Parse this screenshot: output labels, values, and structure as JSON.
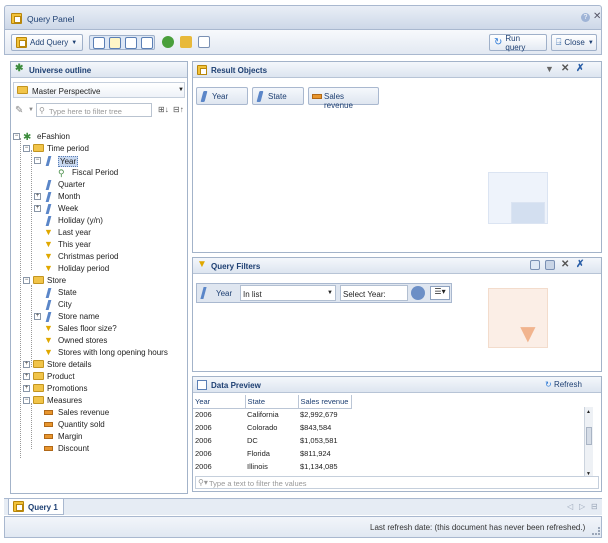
{
  "window": {
    "title": "Query Panel"
  },
  "toolbar": {
    "add_query": "Add Query",
    "run_query": "Run query",
    "close": "Close"
  },
  "universe": {
    "header": "Universe outline",
    "perspective": "Master Perspective",
    "filter_placeholder": "Type here to filter tree",
    "tree": [
      {
        "label": "eFashion"
      },
      {
        "label": "Time period"
      },
      {
        "label": "Year"
      },
      {
        "label": "Fiscal Period"
      },
      {
        "label": "Quarter"
      },
      {
        "label": "Month"
      },
      {
        "label": "Week"
      },
      {
        "label": "Holiday (y/n)"
      },
      {
        "label": "Last year"
      },
      {
        "label": "This year"
      },
      {
        "label": "Christmas period"
      },
      {
        "label": "Holiday period"
      },
      {
        "label": "Store"
      },
      {
        "label": "State"
      },
      {
        "label": "City"
      },
      {
        "label": "Store name"
      },
      {
        "label": "Sales floor size?"
      },
      {
        "label": "Owned stores"
      },
      {
        "label": "Stores with long opening hours"
      },
      {
        "label": "Store details"
      },
      {
        "label": "Product"
      },
      {
        "label": "Promotions"
      },
      {
        "label": "Measures"
      },
      {
        "label": "Sales revenue"
      },
      {
        "label": "Quantity sold"
      },
      {
        "label": "Margin"
      },
      {
        "label": "Discount"
      }
    ]
  },
  "result_objects": {
    "header": "Result Objects",
    "chips": [
      "Year",
      "State",
      "Sales revenue"
    ]
  },
  "query_filters": {
    "header": "Query Filters",
    "field": "Year",
    "operator": "In list",
    "operand": "Select Year:"
  },
  "data_preview": {
    "header": "Data Preview",
    "refresh": "Refresh",
    "columns": [
      "Year",
      "State",
      "Sales revenue"
    ],
    "rows": [
      [
        "2006",
        "California",
        "$2,992,679"
      ],
      [
        "2006",
        "Colorado",
        "$843,584"
      ],
      [
        "2006",
        "DC",
        "$1,053,581"
      ],
      [
        "2006",
        "Florida",
        "$811,924"
      ],
      [
        "2006",
        "Illinois",
        "$1,134,085"
      ]
    ],
    "filter_placeholder": "Type a text to filter the values"
  },
  "tabs": {
    "query1": "Query 1"
  },
  "status": {
    "text": "Last refresh date: (this document has never been refreshed.)"
  },
  "colors": {
    "accent": "#1d3f72",
    "folder": "#f1c449",
    "dimension": "#5b86c8",
    "measure": "#e8962e",
    "filter": "#e0a800"
  }
}
